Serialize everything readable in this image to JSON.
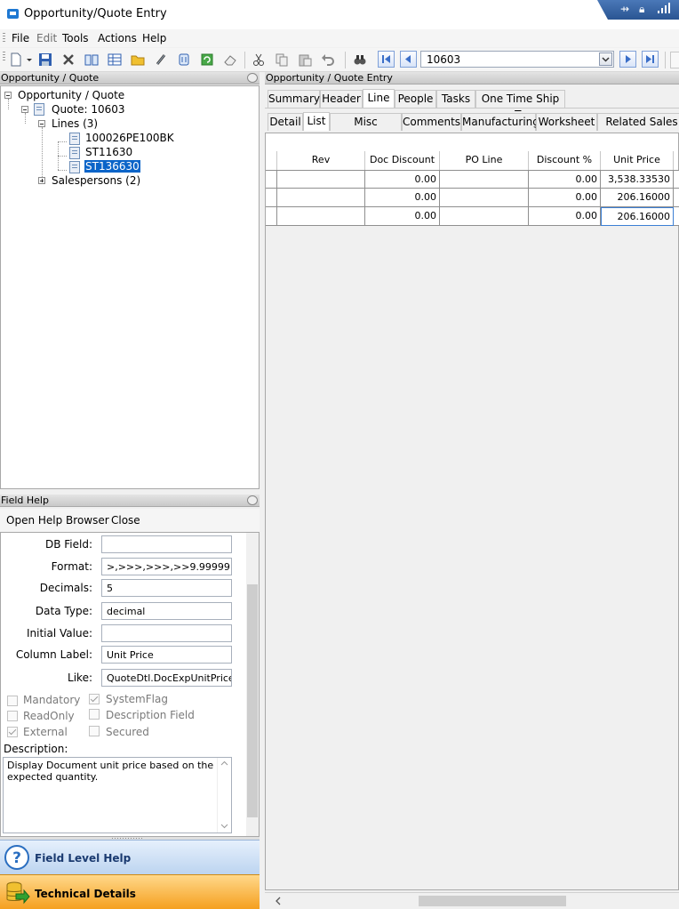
{
  "window": {
    "title": "Opportunity/Quote Entry"
  },
  "menu": {
    "items": [
      "File",
      "Edit",
      "Tools",
      "Actions",
      "Help"
    ]
  },
  "toolbar": {
    "quote_number": "10603"
  },
  "left_panel": {
    "header": "Opportunity / Quote",
    "tree": {
      "root": "Opportunity / Quote",
      "quote": "Quote: 10603",
      "lines": "Lines (3)",
      "line_items": [
        "100026PE100BK",
        "ST11630",
        "ST136630"
      ],
      "salespersons": "Salespersons (2)"
    }
  },
  "field_help": {
    "header": "Field Help",
    "open_help_browser": "Open Help Browser",
    "close": "Close",
    "labels": {
      "db_field": "DB Field:",
      "format": "Format:",
      "decimals": "Decimals:",
      "data_type": "Data Type:",
      "initial_value": "Initial Value:",
      "column_label": "Column Label:",
      "like": "Like:"
    },
    "values": {
      "db_field": "",
      "format": ">,>>>,>>>,>>9.99999",
      "decimals": "5",
      "data_type": "decimal",
      "initial_value": "",
      "column_label": "Unit Price",
      "like": "QuoteDtl.DocExpUnitPrice"
    },
    "checkboxes": {
      "mandatory": "Mandatory",
      "system_flag": "SystemFlag",
      "read_only": "ReadOnly",
      "description_field": "Description Field",
      "external": "External",
      "secured": "Secured"
    },
    "description_label": "Description:",
    "description": "Display Document unit price based on the expected quantity."
  },
  "nav_bars": {
    "field_level_help": "Field Level Help",
    "technical_details": "Technical Details"
  },
  "right_panel": {
    "header": "Opportunity / Quote Entry",
    "main_tabs": [
      "Summary",
      "Header",
      "Line",
      "People",
      "Tasks",
      "One Time Ship To"
    ],
    "sub_tabs": [
      "Detail",
      "List",
      "Misc Charges",
      "Comments",
      "Manufacturing",
      "Worksheet",
      "Related Sales Orc"
    ]
  },
  "grid": {
    "columns": [
      "Rev",
      "Doc Discount",
      "PO Line",
      "Discount %",
      "Unit Price"
    ],
    "rows": [
      [
        "",
        "0.00",
        "",
        "0.00",
        "3,538.33530"
      ],
      [
        "",
        "0.00",
        "",
        "0.00",
        "206.16000"
      ],
      [
        "",
        "0.00",
        "",
        "0.00",
        "206.16000"
      ]
    ]
  }
}
